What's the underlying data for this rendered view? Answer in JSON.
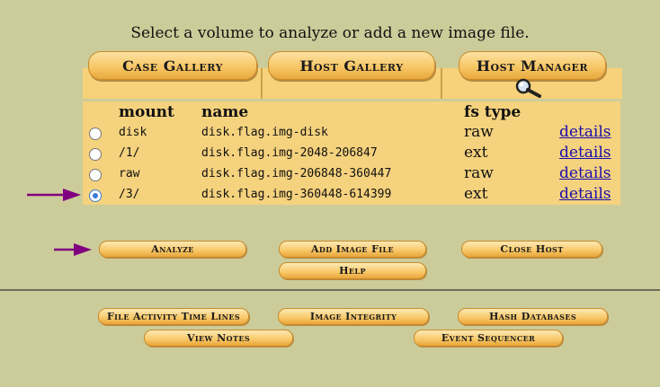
{
  "instruction": "Select a volume to analyze or add a new image file.",
  "tabs": {
    "case_gallery": "Case Gallery",
    "host_gallery": "Host Gallery",
    "host_manager": "Host Manager"
  },
  "icons": {
    "magnifier": "magnifier-icon",
    "arrow": "arrow-right-icon"
  },
  "colors": {
    "page_background": "#cccc9a",
    "panel": "#f5d27e",
    "link": "#1a0dab",
    "arrow": "#800080",
    "radio_selected": "#3b7bd6"
  },
  "volume_table": {
    "headers": {
      "mount": "mount",
      "name": "name",
      "fs_type": "fs type"
    },
    "rows": [
      {
        "mount": "disk",
        "name": "disk.flag.img-disk",
        "fs_type": "raw",
        "details": "details",
        "selected": false
      },
      {
        "mount": "/1/",
        "name": "disk.flag.img-2048-206847",
        "fs_type": "ext",
        "details": "details",
        "selected": false
      },
      {
        "mount": "raw",
        "name": "disk.flag.img-206848-360447",
        "fs_type": "raw",
        "details": "details",
        "selected": false
      },
      {
        "mount": "/3/",
        "name": "disk.flag.img-360448-614399",
        "fs_type": "ext",
        "details": "details",
        "selected": true
      }
    ]
  },
  "actions": {
    "analyze": "Analyze",
    "add_image_file": "Add Image File",
    "close_host": "Close Host",
    "help": "Help"
  },
  "tools": {
    "file_activity": "File Activity Time Lines",
    "image_integrity": "Image Integrity",
    "hash_databases": "Hash Databases",
    "view_notes": "View Notes",
    "event_sequencer": "Event Sequencer"
  }
}
